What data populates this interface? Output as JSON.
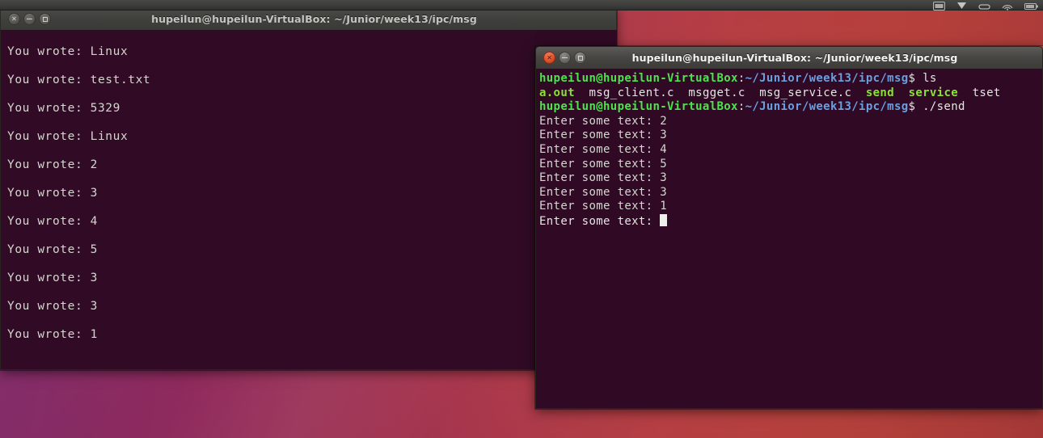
{
  "desktop": {
    "wallpaper_colors": [
      "#7d2a6b",
      "#a8364f",
      "#b9413c"
    ],
    "panel": {
      "indicators": [
        "keyboard-indicator-icon",
        "dropbox-indicator-icon",
        "bluetooth-indicator-icon",
        "network-indicator-icon",
        "battery-indicator-icon"
      ]
    }
  },
  "windows": {
    "left": {
      "title": "hupeilun@hupeilun-VirtualBox: ~/Junior/week13/ipc/msg",
      "focused": false,
      "buttons": {
        "close": "close-button",
        "minimize": "minimize-button",
        "maximize": "maximize-button"
      },
      "lines": [
        "You wrote: Linux",
        "You wrote: test.txt",
        "You wrote: 5329",
        "You wrote: Linux",
        "You wrote: 2",
        "You wrote: 3",
        "You wrote: 4",
        "You wrote: 5",
        "You wrote: 3",
        "You wrote: 3",
        "You wrote: 1"
      ],
      "cursor": "hollow-block"
    },
    "right": {
      "title": "hupeilun@hupeilun-VirtualBox: ~/Junior/week13/ipc/msg",
      "focused": true,
      "buttons": {
        "close": "close-button",
        "minimize": "minimize-button",
        "maximize": "maximize-button"
      },
      "prompt": {
        "user_host": "hupeilun@hupeilun-VirtualBox",
        "separator": ":",
        "path": "~/Junior/week13/ipc/msg",
        "sigil": "$"
      },
      "commands": [
        {
          "type": "prompt",
          "command": " ls"
        },
        {
          "type": "ls-output",
          "entries": [
            {
              "name": "a.out",
              "kind": "exec"
            },
            {
              "name": "msg_client.c",
              "kind": "file"
            },
            {
              "name": "msgget.c",
              "kind": "file"
            },
            {
              "name": "msg_service.c",
              "kind": "file"
            },
            {
              "name": "send",
              "kind": "exec"
            },
            {
              "name": "service",
              "kind": "exec"
            },
            {
              "name": "tset",
              "kind": "file"
            }
          ]
        },
        {
          "type": "prompt",
          "command": " ./send"
        },
        {
          "type": "output",
          "text": "Enter some text: 2"
        },
        {
          "type": "output",
          "text": "Enter some text: 3"
        },
        {
          "type": "output",
          "text": "Enter some text: 4"
        },
        {
          "type": "output",
          "text": "Enter some text: 5"
        },
        {
          "type": "output",
          "text": "Enter some text: 3"
        },
        {
          "type": "output",
          "text": "Enter some text: 3"
        },
        {
          "type": "output",
          "text": "Enter some text: 1"
        },
        {
          "type": "output-cursor",
          "text": "Enter some text: "
        }
      ],
      "cursor": "solid-block"
    }
  },
  "colors": {
    "terminal_bg": "#300a24",
    "prompt_user": "#4ee24e",
    "prompt_path": "#6a9fe0",
    "exec_file": "#8ae234",
    "text_fg": "#d3d7cf",
    "titlebar_active": "#474643",
    "close_button": "#e2542c"
  }
}
